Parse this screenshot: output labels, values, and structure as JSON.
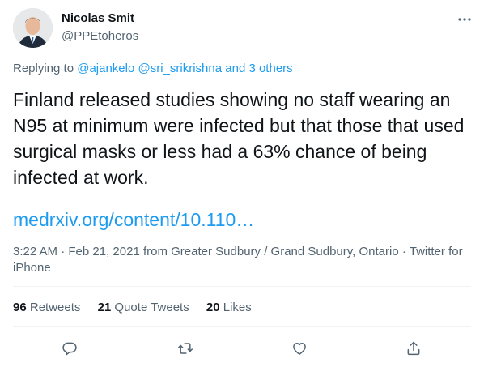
{
  "author": {
    "name": "Nicolas Smit",
    "handle": "@PPEtoheros",
    "avatar_icon": "avatar-photo"
  },
  "reply": {
    "prefix": "Replying to",
    "mention1": "@ajankelo",
    "mention2": "@sri_srikrishna",
    "others": "and 3 others"
  },
  "tweet": {
    "text": "Finland released studies showing no staff wearing an N95 at minimum were infected but that those that used surgical masks or less had a 63% chance of being infected at work.",
    "link": "medrxiv.org/content/10.110…"
  },
  "meta": {
    "time": "3:22 AM",
    "separator": " · ",
    "date": "Feb 21, 2021",
    "location": "from Greater Sudbury / Grand Sudbury, Ontario",
    "source": "Twitter for iPhone"
  },
  "stats": {
    "retweets_count": "96",
    "retweets_label": "Retweets",
    "quotes_count": "21",
    "quotes_label": "Quote Tweets",
    "likes_count": "20",
    "likes_label": "Likes"
  },
  "icons": {
    "more": "more-icon",
    "reply": "reply-icon",
    "retweet": "retweet-icon",
    "like": "heart-icon",
    "share": "share-icon"
  },
  "colors": {
    "accent": "#1d9bf0",
    "secondary_text": "#536471",
    "primary_text": "#0f1419",
    "divider": "#eff3f4"
  }
}
